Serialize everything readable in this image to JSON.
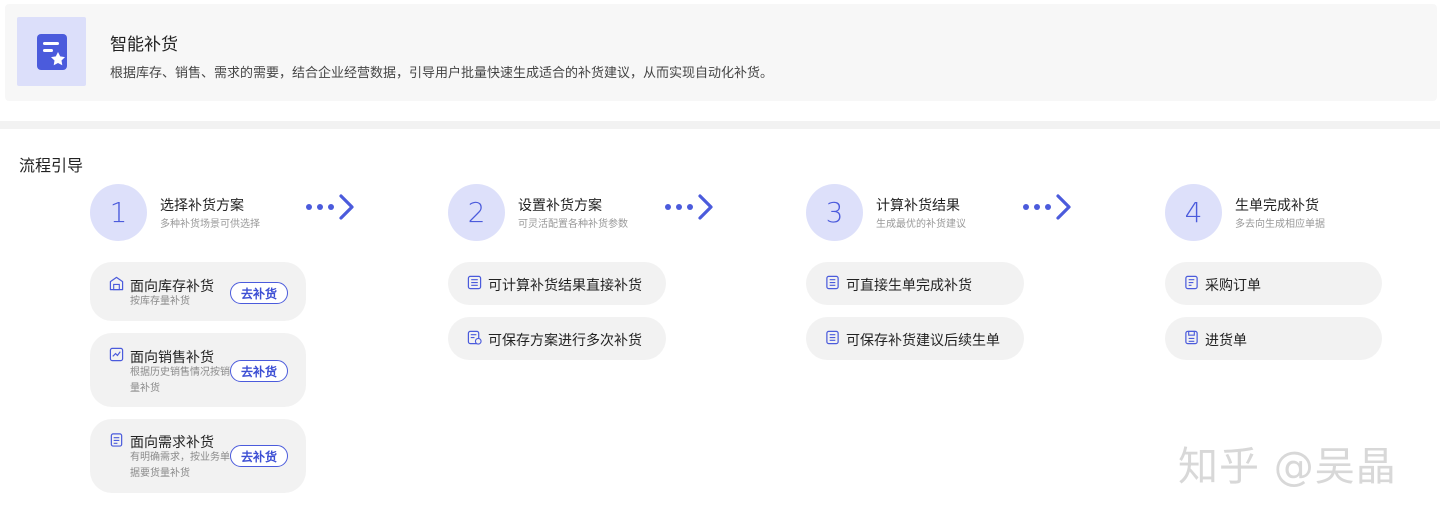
{
  "header": {
    "title": "智能补货",
    "description": "根据库存、销售、需求的需要，结合企业经营数据，引导用户批量快速生成适合的补货建议，从而实现自动化补货。",
    "icon": "star-document-icon"
  },
  "section": {
    "title": "流程引导"
  },
  "steps": [
    {
      "number": "1",
      "title": "选择补货方案",
      "subtitle": "多种补货场景可供选择",
      "items": [
        {
          "label": "面向库存补货",
          "desc": "按库存量补货",
          "button": "去补货",
          "icon": "warehouse-icon"
        },
        {
          "label": "面向销售补货",
          "desc": "根据历史销售情况按销量补货",
          "button": "去补货",
          "icon": "sales-chart-icon"
        },
        {
          "label": "面向需求补货",
          "desc": "有明确需求，按业务单据要货量补货",
          "button": "去补货",
          "icon": "clipboard-icon"
        }
      ]
    },
    {
      "number": "2",
      "title": "设置补货方案",
      "subtitle": "可灵活配置各种补货参数",
      "items": [
        {
          "label": "可计算补货结果直接补货",
          "icon": "calculator-icon"
        },
        {
          "label": "可保存方案进行多次补货",
          "icon": "save-plan-icon"
        }
      ]
    },
    {
      "number": "3",
      "title": "计算补货结果",
      "subtitle": "生成最优的补货建议",
      "items": [
        {
          "label": "可直接生单完成补货",
          "icon": "list-doc-icon"
        },
        {
          "label": "可保存补货建议后续生单",
          "icon": "list-doc-icon"
        }
      ]
    },
    {
      "number": "4",
      "title": "生单完成补货",
      "subtitle": "多去向生成相应单据",
      "items": [
        {
          "label": "采购订单",
          "icon": "purchase-order-icon"
        },
        {
          "label": "进货单",
          "icon": "receipt-icon"
        }
      ]
    }
  ],
  "watermark": "知乎 @吴晶",
  "colors": {
    "accent": "#4b5bdc",
    "circle_bg": "#dde0fa",
    "pill_bg": "#f2f2f2"
  }
}
